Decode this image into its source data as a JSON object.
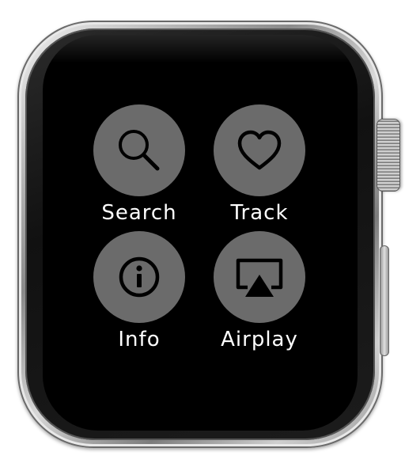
{
  "device": {
    "name": "watch",
    "colors": {
      "screen": "#000000",
      "button_fill": "#6b6b6b",
      "icon_stroke": "#000000",
      "label": "#ffffff"
    }
  },
  "menu": {
    "items": [
      {
        "label": "Search",
        "icon": "search-icon"
      },
      {
        "label": "Track",
        "icon": "heart-icon"
      },
      {
        "label": "Info",
        "icon": "info-icon"
      },
      {
        "label": "Airplay",
        "icon": "airplay-icon"
      }
    ]
  }
}
